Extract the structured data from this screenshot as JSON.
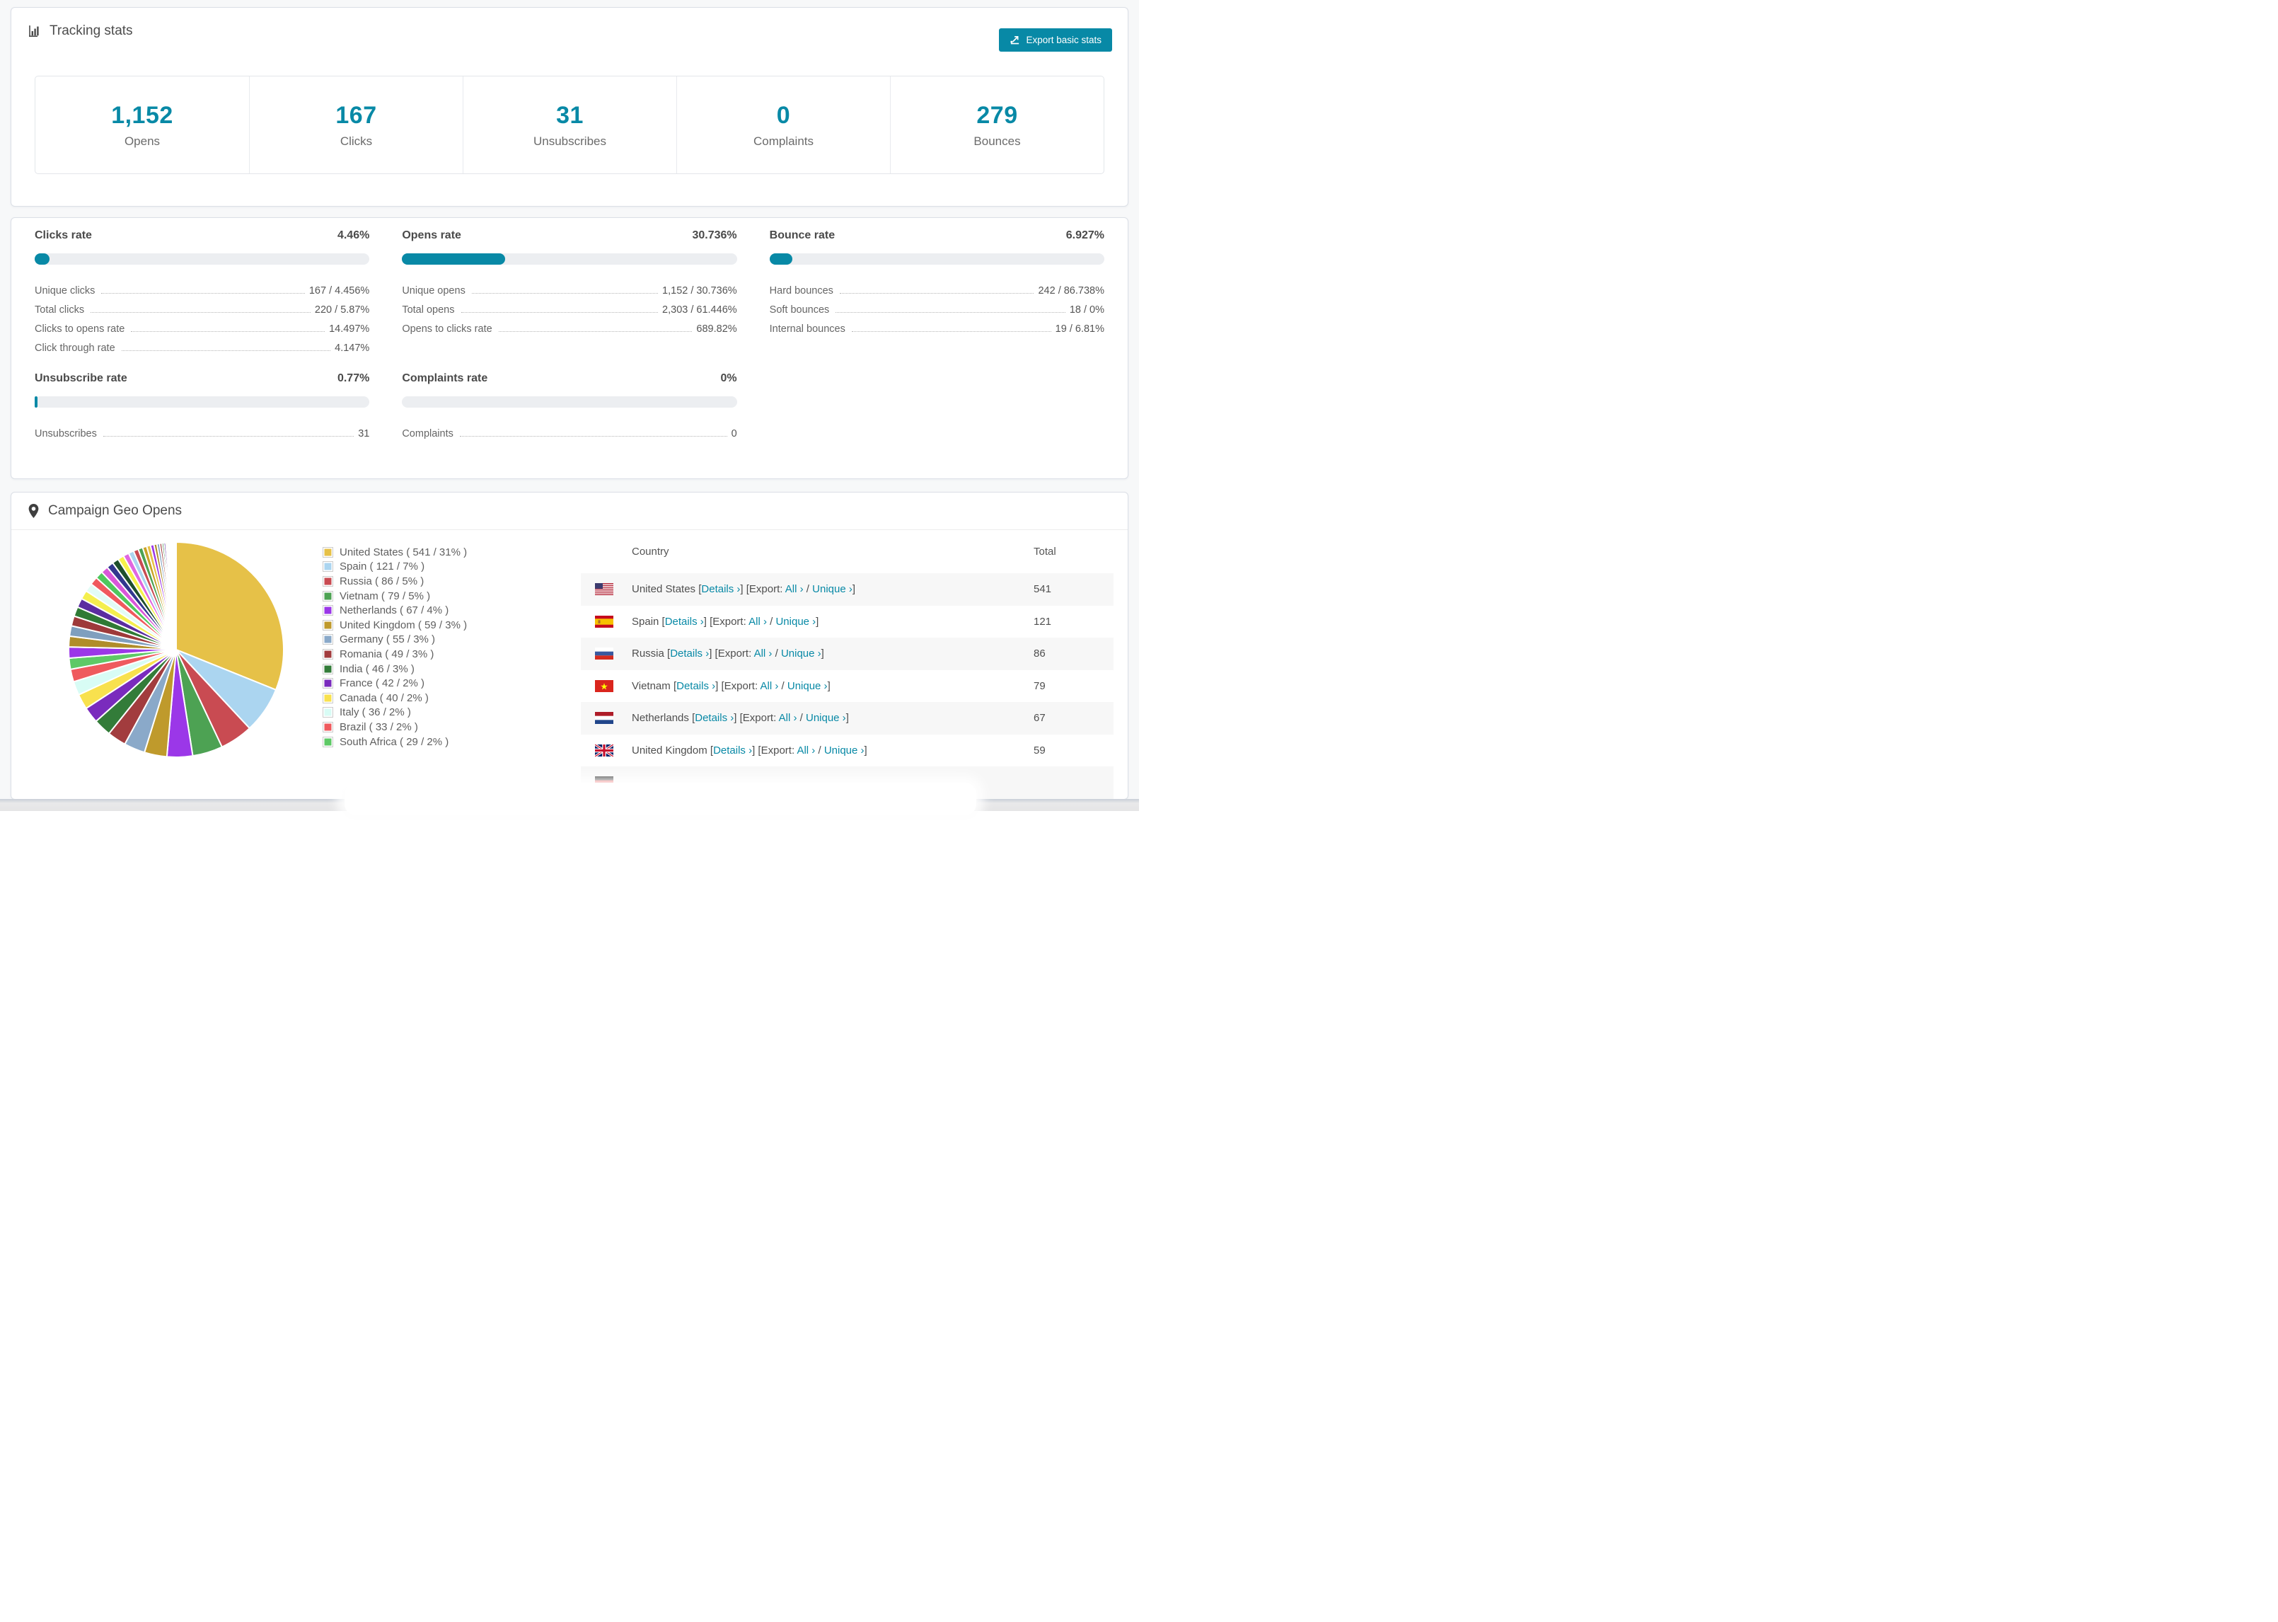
{
  "accent": "#0889a6",
  "tracking": {
    "title": "Tracking stats",
    "export_button": "Export basic stats",
    "stats": [
      {
        "value": "1,152",
        "label": "Opens"
      },
      {
        "value": "167",
        "label": "Clicks"
      },
      {
        "value": "31",
        "label": "Unsubscribes"
      },
      {
        "value": "0",
        "label": "Complaints"
      },
      {
        "value": "279",
        "label": "Bounces"
      }
    ]
  },
  "rates": [
    {
      "title": "Clicks rate",
      "value": "4.46%",
      "percent": 4.46,
      "rows": [
        {
          "label": "Unique clicks",
          "value": "167 / 4.456%"
        },
        {
          "label": "Total clicks",
          "value": "220 / 5.87%"
        },
        {
          "label": "Clicks to opens rate",
          "value": "14.497%"
        },
        {
          "label": "Click through rate",
          "value": "4.147%"
        }
      ]
    },
    {
      "title": "Opens rate",
      "value": "30.736%",
      "percent": 30.736,
      "rows": [
        {
          "label": "Unique opens",
          "value": "1,152 / 30.736%"
        },
        {
          "label": "Total opens",
          "value": "2,303 / 61.446%"
        },
        {
          "label": "Opens to clicks rate",
          "value": "689.82%"
        }
      ]
    },
    {
      "title": "Bounce rate",
      "value": "6.927%",
      "percent": 6.927,
      "rows": [
        {
          "label": "Hard bounces",
          "value": "242 / 86.738%"
        },
        {
          "label": "Soft bounces",
          "value": "18 / 0%"
        },
        {
          "label": "Internal bounces",
          "value": "19 / 6.81%"
        }
      ]
    },
    {
      "title": "Unsubscribe rate",
      "value": "0.77%",
      "percent": 0.77,
      "rows": [
        {
          "label": "Unsubscribes",
          "value": "31"
        }
      ]
    },
    {
      "title": "Complaints rate",
      "value": "0%",
      "percent": 0,
      "rows": [
        {
          "label": "Complaints",
          "value": "0"
        }
      ]
    }
  ],
  "geo": {
    "title": "Campaign Geo Opens",
    "table": {
      "columns": [
        "Country",
        "Total"
      ],
      "details_label": "Details",
      "export_label": "Export:",
      "all_label": "All",
      "unique_label": "Unique",
      "chevron": "›",
      "rows": [
        {
          "flag": "us",
          "country": "United States",
          "total": "541"
        },
        {
          "flag": "es",
          "country": "Spain",
          "total": "121"
        },
        {
          "flag": "ru",
          "country": "Russia",
          "total": "86"
        },
        {
          "flag": "vn",
          "country": "Vietnam",
          "total": "79"
        },
        {
          "flag": "nl",
          "country": "Netherlands",
          "total": "67"
        },
        {
          "flag": "gb",
          "country": "United Kingdom",
          "total": "59"
        },
        {
          "flag": "de",
          "country": "",
          "total": "",
          "partial": true
        }
      ]
    }
  },
  "chart_data": {
    "type": "pie",
    "title": "Campaign Geo Opens",
    "legend_position": "right",
    "start_angle": -90,
    "direction": "clockwise",
    "labels": [
      "United States",
      "Spain",
      "Russia",
      "Vietnam",
      "Netherlands",
      "United Kingdom",
      "Germany",
      "Romania",
      "India",
      "France",
      "Canada",
      "Italy",
      "Brazil",
      "South Africa"
    ],
    "values": [
      541,
      121,
      86,
      79,
      67,
      59,
      55,
      49,
      46,
      42,
      40,
      36,
      33,
      29
    ],
    "percents": [
      31,
      7,
      5,
      5,
      4,
      3,
      3,
      3,
      3,
      2,
      2,
      2,
      2,
      2
    ],
    "colors": [
      "#e6c148",
      "#abd5f0",
      "#c94b52",
      "#4da253",
      "#9b37e8",
      "#bf9a2c",
      "#8aa9c9",
      "#a23c3e",
      "#337c39",
      "#7a2bbd",
      "#f8e14e",
      "#d8fcf5",
      "#ef5a5e",
      "#5ec966"
    ],
    "others_note": "remaining unlabeled small slices, estimated",
    "others_values": [
      29,
      28,
      27,
      26,
      25,
      24,
      23,
      22,
      21,
      20,
      19,
      18,
      17,
      16,
      15,
      14,
      13,
      12,
      11,
      10,
      9,
      8,
      7,
      6,
      5,
      5,
      4,
      4,
      3,
      3,
      2,
      2,
      2,
      1,
      1,
      1,
      1,
      1,
      1,
      1
    ],
    "others_palette": [
      "#9b37e8",
      "#b08d2a",
      "#7f9fbe",
      "#9e3a3a",
      "#2f7a35",
      "#5b2da0",
      "#f4ef4e",
      "#e2fcf6",
      "#f0595e",
      "#4fc75d",
      "#d957d9",
      "#32378f",
      "#1e4f2c",
      "#f6f24a",
      "#e066e0",
      "#abd5f0",
      "#c94b52",
      "#4da253",
      "#c9a227",
      "#e6c148"
    ]
  }
}
